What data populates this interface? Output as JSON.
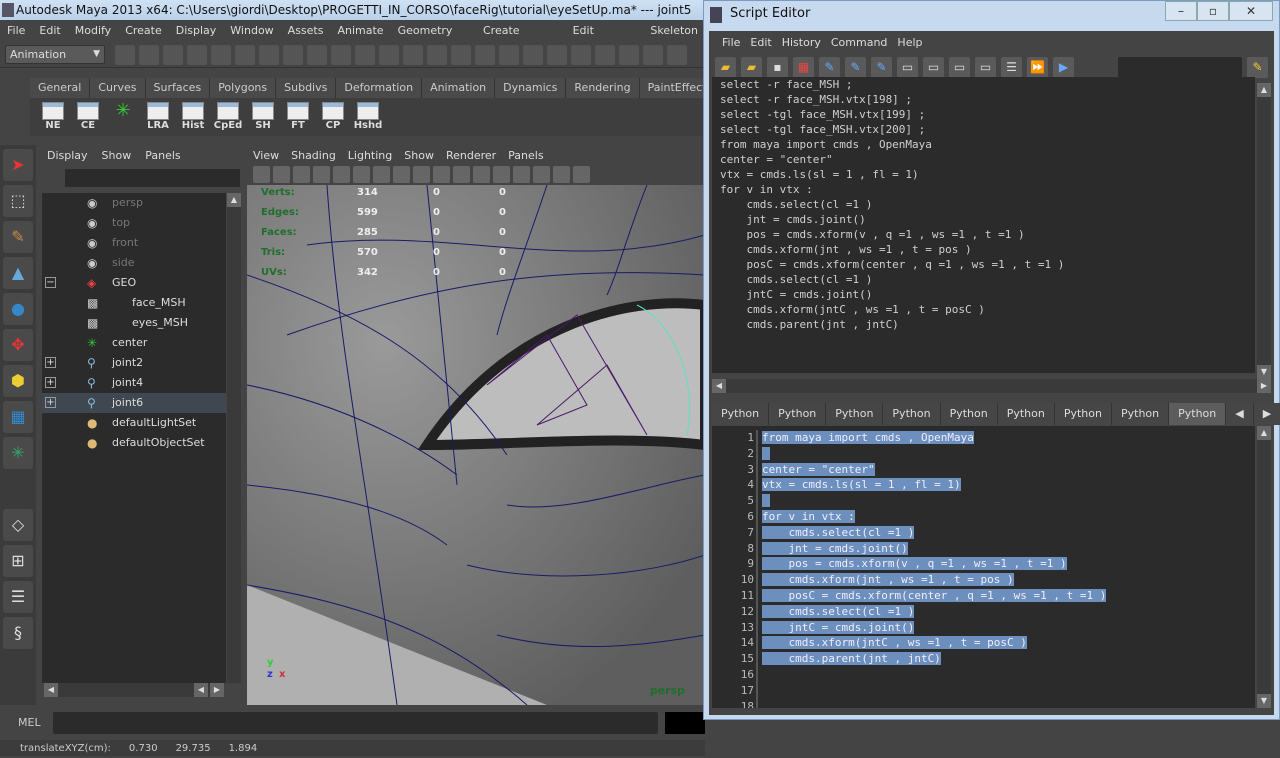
{
  "maya": {
    "title": "Autodesk Maya 2013 x64: C:\\Users\\giordi\\Desktop\\PROGETTI_IN_CORSO\\faceRig\\tutorial\\eyeSetUp.ma*   ---   joint5",
    "menus": [
      "File",
      "Edit",
      "Modify",
      "Create",
      "Display",
      "Window",
      "Assets",
      "Animate",
      "Geometry Cache",
      "Create Deformers",
      "Edit Deformers",
      "Skeleton"
    ],
    "mode": "Animation",
    "shelf_tabs": [
      "General",
      "Curves",
      "Surfaces",
      "Polygons",
      "Subdivs",
      "Deformation",
      "Animation",
      "Dynamics",
      "Rendering",
      "PaintEffects"
    ],
    "shelf_buttons": [
      "NE",
      "CE",
      "",
      "LRA",
      "Hist",
      "CpEd",
      "SH",
      "FT",
      "CP",
      "Hshd"
    ],
    "outliner": {
      "menus": [
        "Display",
        "Show",
        "Panels"
      ],
      "items": [
        {
          "label": "persp",
          "icon": "camera",
          "dim": true
        },
        {
          "label": "top",
          "icon": "camera",
          "dim": true
        },
        {
          "label": "front",
          "icon": "camera",
          "dim": true
        },
        {
          "label": "side",
          "icon": "camera",
          "dim": true
        },
        {
          "label": "GEO",
          "icon": "group",
          "exp": "−"
        },
        {
          "label": "face_MSH",
          "icon": "mesh",
          "indent": true
        },
        {
          "label": "eyes_MSH",
          "icon": "mesh",
          "indent": true
        },
        {
          "label": "center",
          "icon": "locator"
        },
        {
          "label": "joint2",
          "icon": "joint",
          "exp": "+"
        },
        {
          "label": "joint4",
          "icon": "joint",
          "exp": "+"
        },
        {
          "label": "joint6",
          "icon": "joint",
          "exp": "+",
          "selected": true
        },
        {
          "label": "defaultLightSet",
          "icon": "set"
        },
        {
          "label": "defaultObjectSet",
          "icon": "set"
        }
      ]
    },
    "viewport": {
      "menus": [
        "View",
        "Shading",
        "Lighting",
        "Show",
        "Renderer",
        "Panels"
      ],
      "hud": [
        {
          "label": "Verts:",
          "v": "314",
          "a": "0",
          "b": "0"
        },
        {
          "label": "Edges:",
          "v": "599",
          "a": "0",
          "b": "0"
        },
        {
          "label": "Faces:",
          "v": "285",
          "a": "0",
          "b": "0"
        },
        {
          "label": "Tris:",
          "v": "570",
          "a": "0",
          "b": "0"
        },
        {
          "label": "UVs:",
          "v": "342",
          "a": "0",
          "b": "0"
        }
      ],
      "camera": "persp"
    },
    "mel_label": "MEL",
    "help": {
      "label": "translateXYZ(cm):",
      "x": "0.730",
      "y": "29.735",
      "z": "1.894"
    }
  },
  "script_editor": {
    "title": "Script Editor",
    "menus": [
      "File",
      "Edit",
      "History",
      "Command",
      "Help"
    ],
    "history": [
      "select -r face_MSH ;",
      "select -r face_MSH.vtx[198] ;",
      "select -tgl face_MSH.vtx[199] ;",
      "select -tgl face_MSH.vtx[200] ;",
      "from maya import cmds , OpenMaya",
      "",
      "center = \"center\"",
      "vtx = cmds.ls(sl = 1 , fl = 1)",
      "",
      "for v in vtx :",
      "    cmds.select(cl =1 )",
      "    jnt = cmds.joint()",
      "    pos = cmds.xform(v , q =1 , ws =1 , t =1 )",
      "    cmds.xform(jnt , ws =1 , t = pos )",
      "    posC = cmds.xform(center , q =1 , ws =1 , t =1 )",
      "    cmds.select(cl =1 )",
      "    jntC = cmds.joint()",
      "    cmds.xform(jntC , ws =1 , t = posC )",
      "    cmds.parent(jnt , jntC)"
    ],
    "tabs": [
      "Python",
      "Python",
      "Python",
      "Python",
      "Python",
      "Python",
      "Python",
      "Python",
      "Python"
    ],
    "active_tab": 8,
    "code": [
      "from maya import cmds , OpenMaya",
      "",
      "center = \"center\"",
      "vtx = cmds.ls(sl = 1 , fl = 1)",
      "",
      "for v in vtx :",
      "    cmds.select(cl =1 )",
      "    jnt = cmds.joint()",
      "    pos = cmds.xform(v , q =1 , ws =1 , t =1 )",
      "    cmds.xform(jnt , ws =1 , t = pos )",
      "    posC = cmds.xform(center , q =1 , ws =1 , t =1 )",
      "    cmds.select(cl =1 )",
      "    jntC = cmds.joint()",
      "    cmds.xform(jntC , ws =1 , t = posC )",
      "    cmds.parent(jnt , jntC)",
      "",
      "",
      ""
    ],
    "selected_lines": 15
  }
}
